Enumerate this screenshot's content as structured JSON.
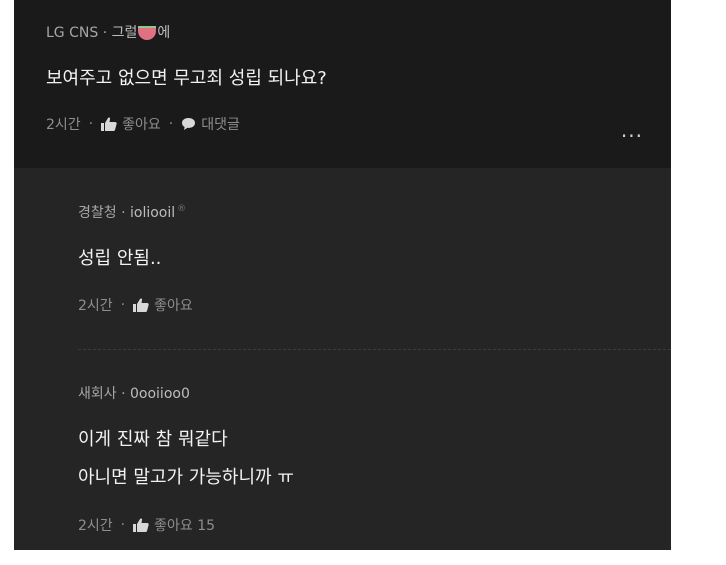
{
  "post": {
    "company": "LG CNS",
    "separator": "·",
    "nickname": "그럴",
    "nickname_suffix": "에",
    "text": "보여주고 없으면 무고죄 성립 되나요?",
    "time": "2시간",
    "like_label": "좋아요",
    "reply_label": "대댓글",
    "more_label": "..."
  },
  "comments": [
    {
      "company": "경찰청",
      "separator": "·",
      "nickname": "ioliooil",
      "lines": [
        "성립 안됨.."
      ],
      "time": "2시간",
      "like_label": "좋아요"
    },
    {
      "company": "새회사",
      "separator": "·",
      "nickname": "0ooiioo0",
      "lines": [
        "이게 진짜 참 뭐같다",
        "아니면 말고가 가능하니까 ㅠ"
      ],
      "time": "2시간",
      "like_label": "좋아요 15"
    }
  ],
  "icons": {
    "like": "thumbs-up-icon",
    "reply": "speech-bubble-icon",
    "more": "more-dots-icon",
    "emoji": "watermelon-icon",
    "verified": "verified-mark-icon"
  },
  "colors": {
    "post_background": "#1a1a1a",
    "reply_background": "#252525",
    "text": "#f2f2f2",
    "meta": "#a6a6a6"
  }
}
